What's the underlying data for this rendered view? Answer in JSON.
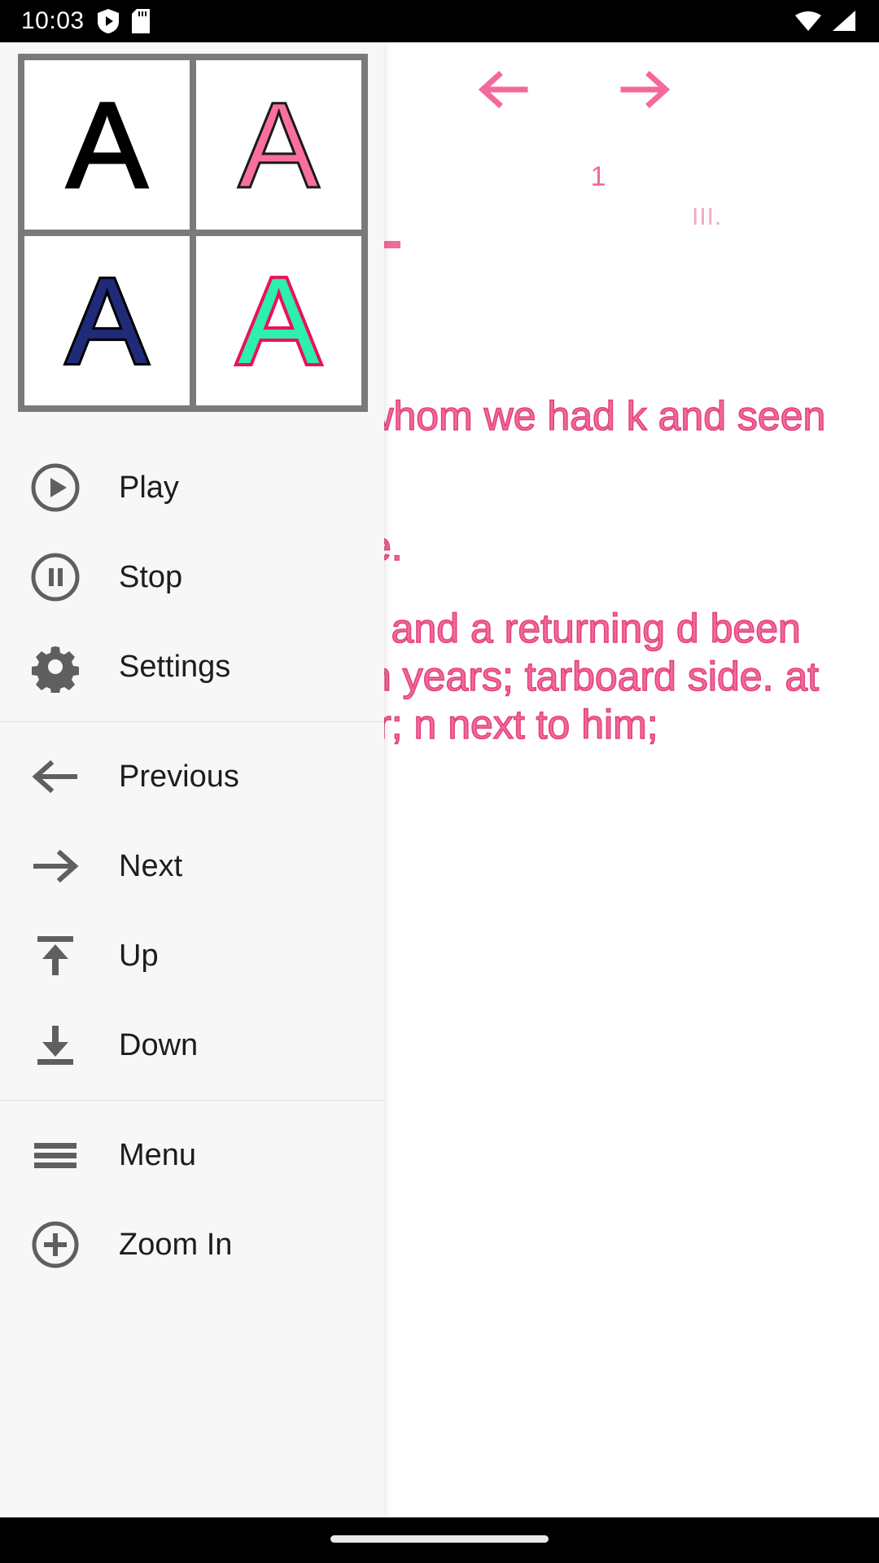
{
  "status_bar": {
    "time": "10:03",
    "icons": [
      "shield-play-icon",
      "sd-card-icon",
      "wifi-icon",
      "cellular-signal-icon"
    ]
  },
  "reader": {
    "prev_page_label": "←",
    "next_page_label": "→",
    "page_number": "1",
    "chapter_marker": "III.",
    "paragraphs": [
      "ck, the same whom we had k and seen eakfast this",
      "evening before.",
      "hip-masters, a and a returning d been absent thirteen years; tarboard side. at the Reverend r; n next to him;"
    ],
    "text_color": "#f4699c",
    "accent_color": "#f2699b"
  },
  "menu": {
    "color_grid": {
      "title": "font-color-swatches",
      "swatches": [
        {
          "letter": "A",
          "fill": "#000000",
          "stroke": "#000000",
          "name": "black-on-white"
        },
        {
          "letter": "A",
          "fill": "#fb6f9d",
          "stroke": "#1a1a1a",
          "name": "pink-on-white"
        },
        {
          "letter": "A",
          "fill": "#1f2a78",
          "stroke": "#000000",
          "name": "navy-outlined"
        },
        {
          "letter": "A",
          "fill": "#2cf0ae",
          "stroke": "#ec1157",
          "name": "green-crimson-outlined"
        }
      ]
    },
    "groups": [
      {
        "name": "playback",
        "items": [
          {
            "label": "Play",
            "icon": "play-circle-icon"
          },
          {
            "label": "Stop",
            "icon": "pause-circle-icon"
          },
          {
            "label": "Settings",
            "icon": "gear-icon"
          }
        ]
      },
      {
        "name": "navigation",
        "items": [
          {
            "label": "Previous",
            "icon": "arrow-left-icon"
          },
          {
            "label": "Next",
            "icon": "arrow-right-icon"
          },
          {
            "label": "Up",
            "icon": "arrow-up-to-line-icon"
          },
          {
            "label": "Down",
            "icon": "arrow-down-to-line-icon"
          }
        ]
      },
      {
        "name": "view",
        "items": [
          {
            "label": "Menu",
            "icon": "hamburger-menu-icon"
          },
          {
            "label": "Zoom In",
            "icon": "zoom-in-icon"
          }
        ]
      }
    ]
  }
}
